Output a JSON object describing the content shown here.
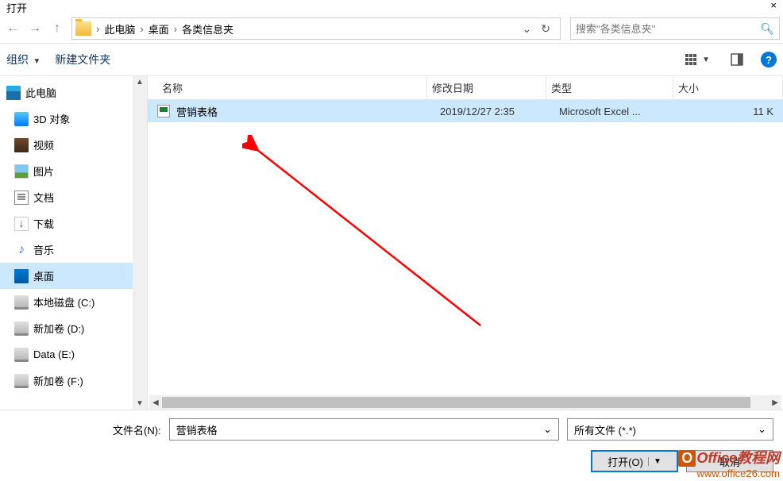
{
  "window": {
    "title": "打开"
  },
  "nav": {
    "breadcrumbs": [
      "此电脑",
      "桌面",
      "各类信息夹"
    ],
    "search_placeholder": "搜索\"各类信息夹\""
  },
  "toolbar": {
    "organize": "组织",
    "new_folder": "新建文件夹"
  },
  "sidebar": {
    "items": [
      {
        "label": "此电脑",
        "icon": "pc",
        "indent": 0
      },
      {
        "label": "3D 对象",
        "icon": "3d",
        "indent": 1
      },
      {
        "label": "视频",
        "icon": "video",
        "indent": 1
      },
      {
        "label": "图片",
        "icon": "pic",
        "indent": 1
      },
      {
        "label": "文档",
        "icon": "doc",
        "indent": 1
      },
      {
        "label": "下载",
        "icon": "down",
        "indent": 1
      },
      {
        "label": "音乐",
        "icon": "music",
        "indent": 1
      },
      {
        "label": "桌面",
        "icon": "desktop",
        "indent": 1,
        "selected": true
      },
      {
        "label": "本地磁盘 (C:)",
        "icon": "disk",
        "indent": 1
      },
      {
        "label": "新加卷 (D:)",
        "icon": "disk",
        "indent": 1
      },
      {
        "label": "Data (E:)",
        "icon": "disk",
        "indent": 1
      },
      {
        "label": "新加卷 (F:)",
        "icon": "disk",
        "indent": 1
      }
    ]
  },
  "columns": {
    "name": "名称",
    "date": "修改日期",
    "type": "类型",
    "size": "大小"
  },
  "files": [
    {
      "name": "营销表格",
      "date": "2019/12/27 2:35",
      "type": "Microsoft Excel ...",
      "size": "11 K",
      "selected": true
    }
  ],
  "footer": {
    "filename_label": "文件名(N):",
    "filename_value": "营销表格",
    "filter": "所有文件 (*.*)",
    "open_btn": "打开(O)",
    "cancel_btn": "取消"
  },
  "watermark": {
    "brand": "Office教程网",
    "url": "www.office26.com"
  }
}
